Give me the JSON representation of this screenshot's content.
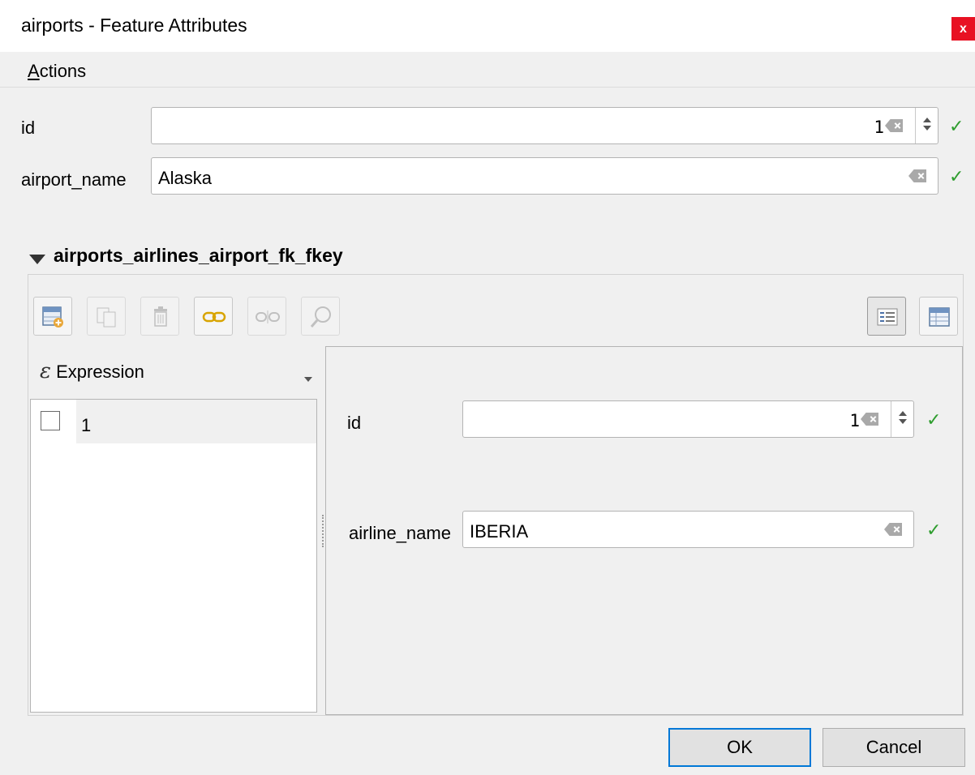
{
  "window": {
    "title": "airports - Feature Attributes",
    "close_label": "x"
  },
  "menu": {
    "actions_underline": "A",
    "actions_rest": "ctions"
  },
  "form": {
    "id_label": "id",
    "id_value": "1",
    "airport_name_label": "airport_name",
    "airport_name_value": "Alaska"
  },
  "relation": {
    "title": "airports_airlines_airport_fk_fkey",
    "toolbar": [
      {
        "name": "add-child-feature-icon",
        "enabled": true
      },
      {
        "name": "duplicate-feature-icon",
        "enabled": false
      },
      {
        "name": "delete-feature-icon",
        "enabled": false
      },
      {
        "name": "link-feature-icon",
        "enabled": true
      },
      {
        "name": "unlink-feature-icon",
        "enabled": false
      },
      {
        "name": "zoom-to-feature-icon",
        "enabled": false
      },
      {
        "name": "form-view-icon",
        "enabled": true,
        "active": true
      },
      {
        "name": "table-view-icon",
        "enabled": true
      }
    ],
    "expression_label": "Expression",
    "list_items": [
      "1"
    ],
    "child_form": {
      "id_label": "id",
      "id_value": "1",
      "airline_name_label": "airline_name",
      "airline_name_value": "IBERIA"
    }
  },
  "buttons": {
    "ok": "OK",
    "cancel": "Cancel"
  },
  "colors": {
    "accent": "#0078d7",
    "check": "#2e9d2e",
    "close": "#e81123"
  }
}
